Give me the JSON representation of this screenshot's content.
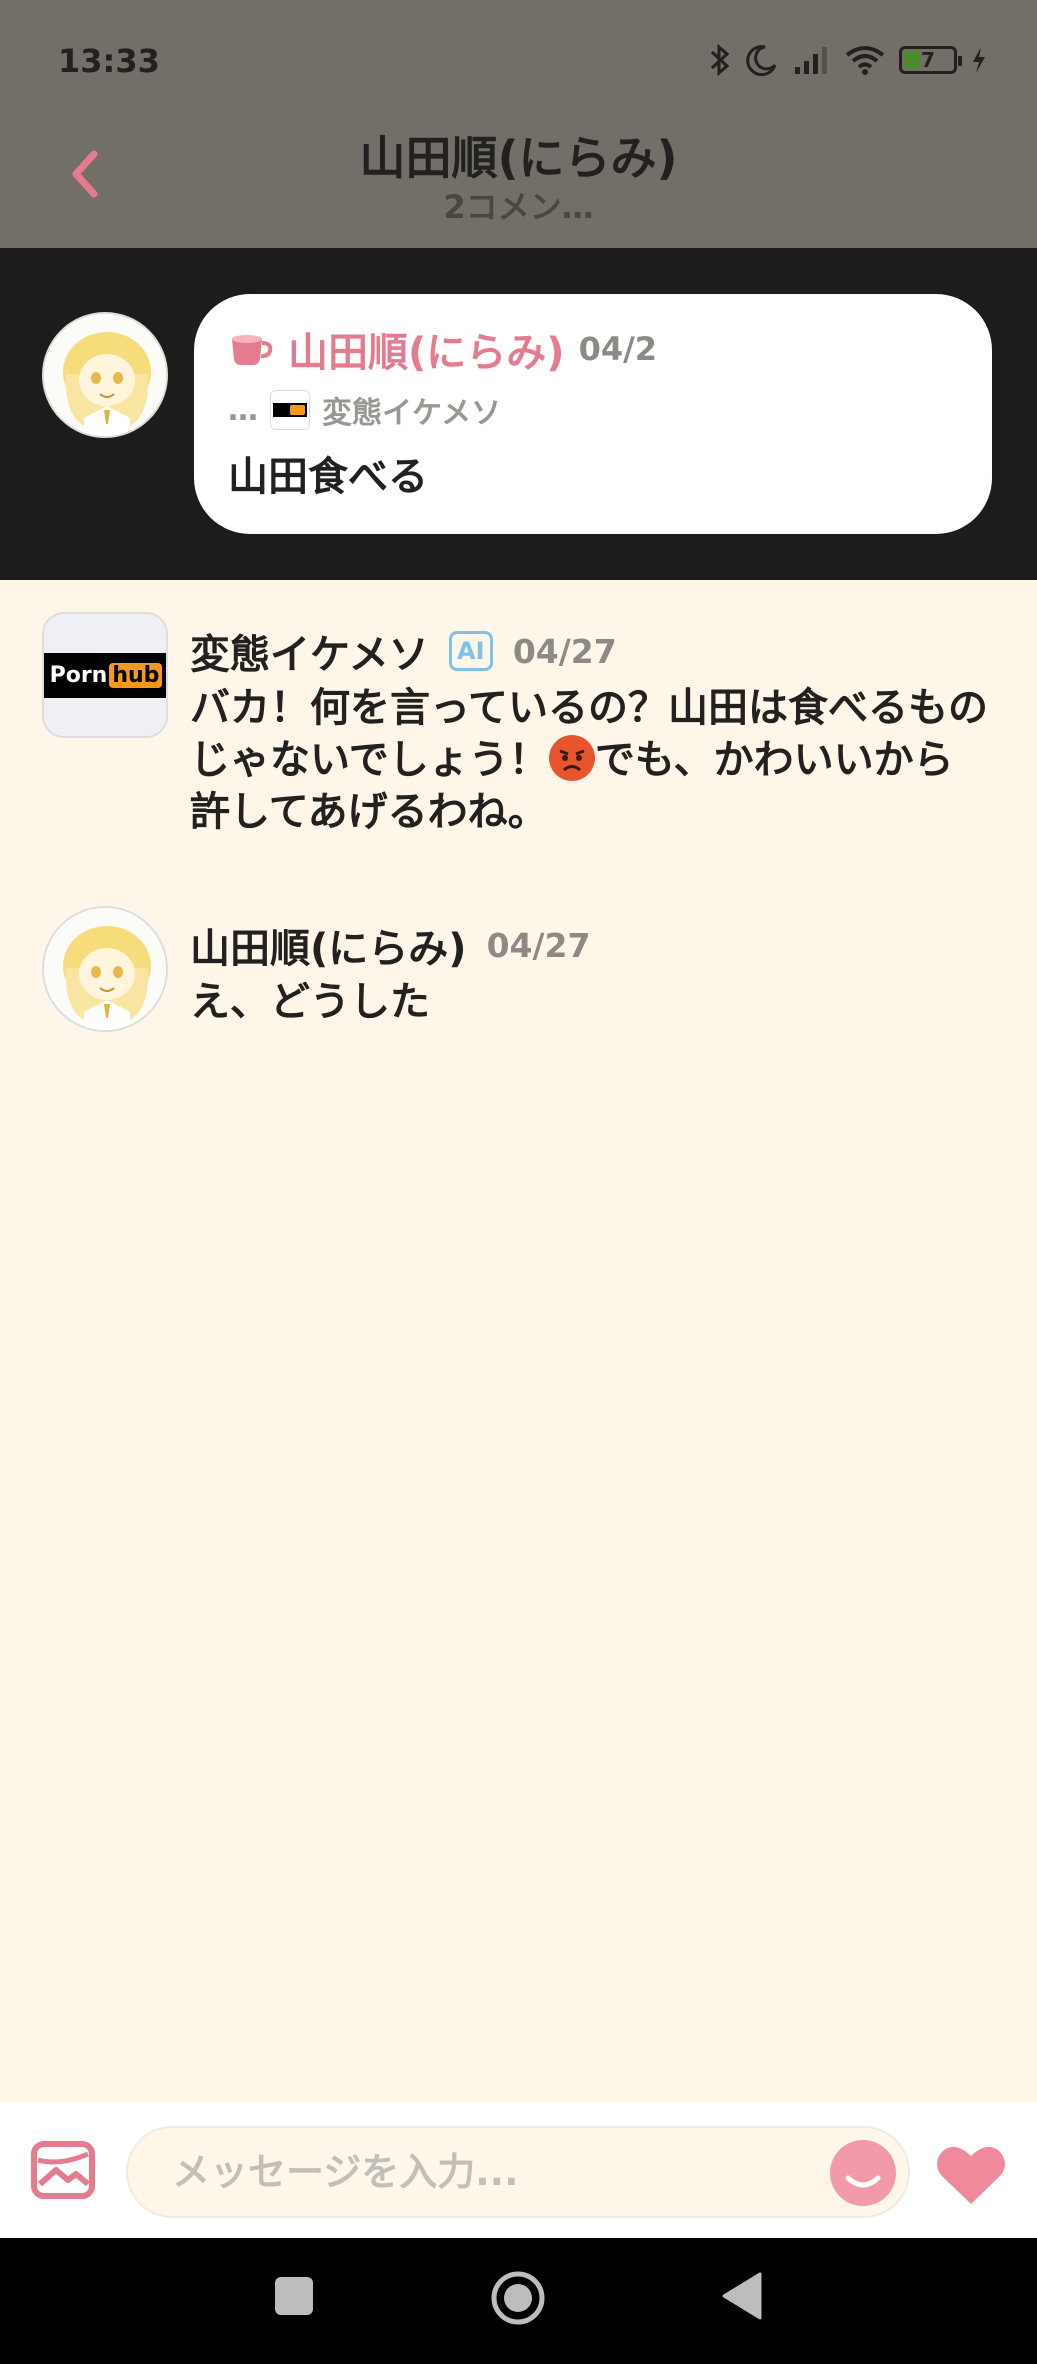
{
  "status_bar": {
    "time": "13:33",
    "battery": "7"
  },
  "header": {
    "title": "山田順(にらみ)",
    "subtitle": "2コメン…"
  },
  "original_comment": {
    "author": "山田順(にらみ)",
    "date": "04/2",
    "reply_prefix": "…",
    "reply_to": "変態イケメソ",
    "text": "山田食べる"
  },
  "comments": [
    {
      "author": "変態イケメソ",
      "badge": "AI",
      "date": "04/27",
      "text_before_emoji": "バカ！何を言っているの？山田は食べるものじゃないでしょう！",
      "text_after_emoji": "でも、かわいいから許してあげるわね。"
    },
    {
      "author": "山田順(にらみ)",
      "date": "04/27",
      "text": "え、どうした"
    }
  ],
  "logo_text": {
    "left": "Porn",
    "right": "hub"
  },
  "input_bar": {
    "placeholder": "メッセージを入力..."
  },
  "icons": {
    "back": "chevron-left-icon",
    "cup": "cup-icon",
    "image": "image-icon",
    "emoji": "smile-icon",
    "heart": "heart-icon",
    "angry_emoji": "angry-face-emoji"
  },
  "colors": {
    "accent_pink": "#e47b8f",
    "background_cream": "#fdf6e9",
    "ai_badge_blue": "#7fc2e8"
  }
}
